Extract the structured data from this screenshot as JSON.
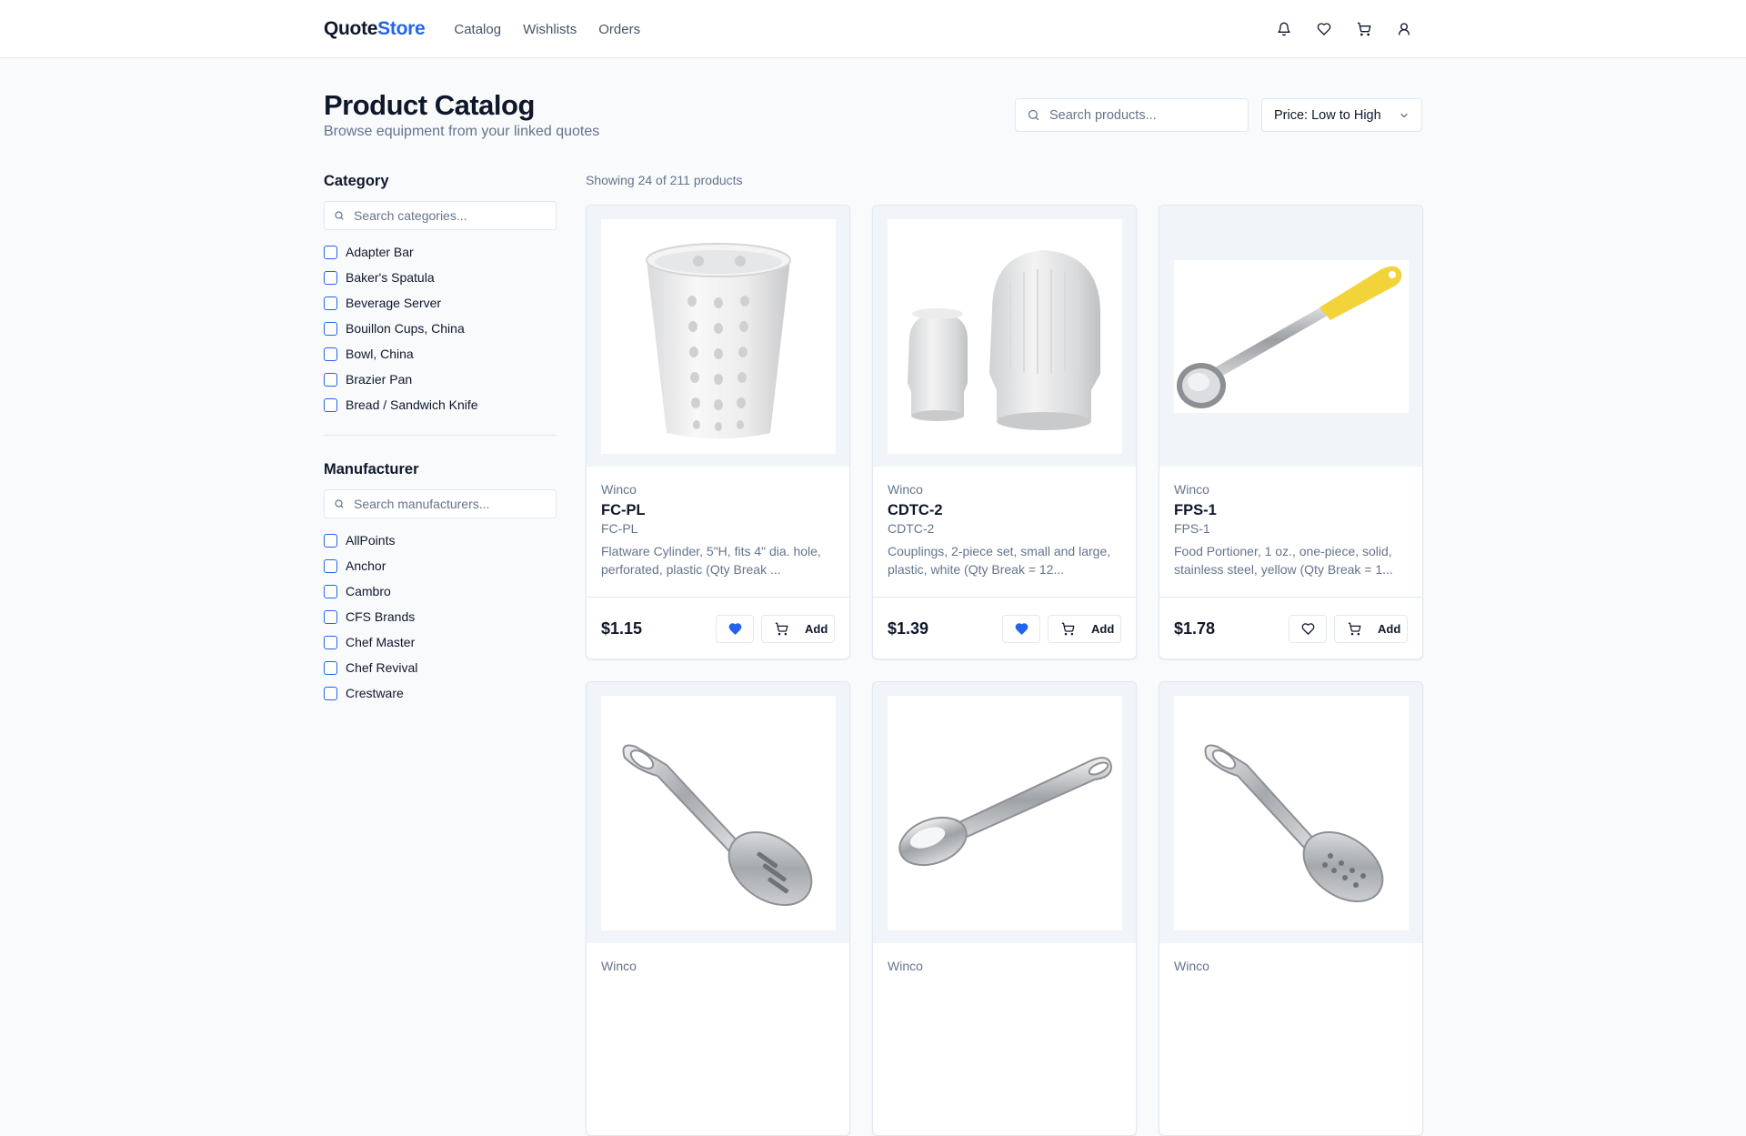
{
  "header": {
    "logo_primary": "Quote",
    "logo_accent": "Store",
    "nav": [
      "Catalog",
      "Wishlists",
      "Orders"
    ],
    "icons": [
      "bell-icon",
      "heart-icon",
      "cart-icon",
      "user-icon"
    ]
  },
  "main": {
    "title": "Product Catalog",
    "subtitle": "Browse equipment from your linked quotes",
    "search_placeholder": "Search products...",
    "sort_value": "Price: Low to High",
    "showing": "Showing 24 of 211 products"
  },
  "sidebar": {
    "category_title": "Category",
    "category_search_placeholder": "Search categories...",
    "categories": [
      "Adapter Bar",
      "Baker's Spatula",
      "Beverage Server",
      "Bouillon Cups, China",
      "Bowl, China",
      "Brazier Pan",
      "Bread / Sandwich Knife"
    ],
    "manufacturer_title": "Manufacturer",
    "manufacturer_search_placeholder": "Search manufacturers...",
    "manufacturers": [
      "AllPoints",
      "Anchor",
      "Cambro",
      "CFS Brands",
      "Chef Master",
      "Chef Revival",
      "Crestware"
    ]
  },
  "products": [
    {
      "brand": "Winco",
      "model": "FC-PL",
      "sku": "FC-PL",
      "desc": "Flatware Cylinder, 5\"H, fits 4\" dia. hole, perforated, plastic (Qty Break ...",
      "price": "$1.15",
      "wishlisted": true,
      "add_label": "Add",
      "image": "cylinder"
    },
    {
      "brand": "Winco",
      "model": "CDTC-2",
      "sku": "CDTC-2",
      "desc": "Couplings, 2-piece set, small and large, plastic, white (Qty Break = 12...",
      "price": "$1.39",
      "wishlisted": true,
      "add_label": "Add",
      "image": "couplings"
    },
    {
      "brand": "Winco",
      "model": "FPS-1",
      "sku": "FPS-1",
      "desc": "Food Portioner, 1 oz., one-piece, solid, stainless steel, yellow (Qty Break = 1...",
      "price": "$1.78",
      "wishlisted": false,
      "add_label": "Add",
      "image": "portioner"
    },
    {
      "brand": "Winco",
      "image": "slotted-spoon"
    },
    {
      "brand": "Winco",
      "image": "solid-spoon"
    },
    {
      "brand": "Winco",
      "image": "perforated-spoon"
    }
  ],
  "colors": {
    "accent": "#2563eb",
    "portioner_handle": "#f2d33a"
  }
}
